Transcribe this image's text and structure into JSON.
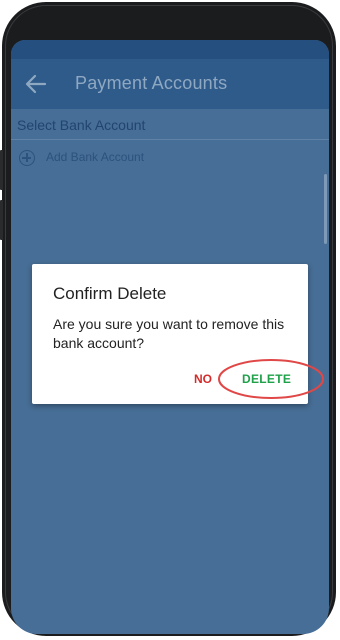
{
  "app_bar": {
    "title": "Payment Accounts",
    "back_icon": "arrow-left-icon"
  },
  "content": {
    "section_title": "Select Bank Account",
    "add_bank_label": "Add Bank Account",
    "add_icon": "plus-circle-icon"
  },
  "dialog": {
    "title": "Confirm Delete",
    "message": "Are you sure you want to remove this bank account?",
    "no_label": "NO",
    "delete_label": "DELETE"
  },
  "colors": {
    "app_bar": "#2f5b8b",
    "screen_dim": "#476e96",
    "no_button": "#d52b2b",
    "delete_button": "#1fa14a",
    "highlight_ring": "#e04747"
  }
}
